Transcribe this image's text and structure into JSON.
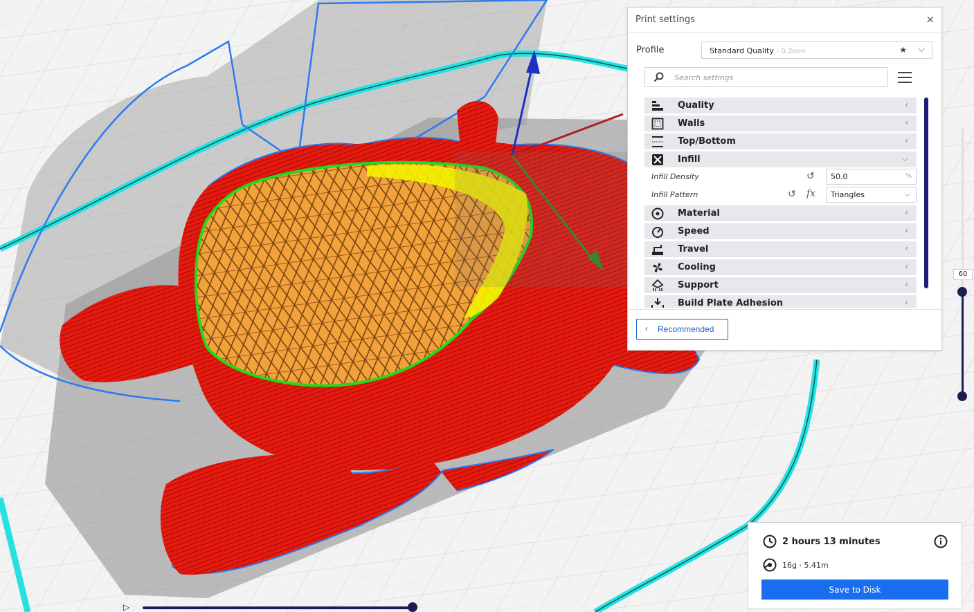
{
  "print_settings": {
    "title": "Print settings",
    "close": "×",
    "profile_label": "Profile",
    "profile_name": "Standard Quality",
    "profile_sub": "- 0.2mm",
    "search_placeholder": "Search settings",
    "categories": [
      {
        "label": "Quality",
        "icon": "quality-icon",
        "expanded": false
      },
      {
        "label": "Walls",
        "icon": "walls-icon",
        "expanded": false
      },
      {
        "label": "Top/Bottom",
        "icon": "top-bottom-icon",
        "expanded": false
      },
      {
        "label": "Infill",
        "icon": "infill-icon",
        "expanded": true
      },
      {
        "label": "Material",
        "icon": "material-icon",
        "expanded": false
      },
      {
        "label": "Speed",
        "icon": "speed-icon",
        "expanded": false
      },
      {
        "label": "Travel",
        "icon": "travel-icon",
        "expanded": false
      },
      {
        "label": "Cooling",
        "icon": "cooling-icon",
        "expanded": false
      },
      {
        "label": "Support",
        "icon": "support-icon",
        "expanded": false
      },
      {
        "label": "Build Plate Adhesion",
        "icon": "adhesion-icon",
        "expanded": false
      }
    ],
    "infill_density_label": "Infill Density",
    "infill_density_value": "50.0",
    "infill_density_unit": "%",
    "infill_pattern_label": "Infill Pattern",
    "infill_pattern_value": "Triangles",
    "recommended_label": "Recommended"
  },
  "layer_slider": {
    "value": "60"
  },
  "summary": {
    "time": "2 hours 13 minutes",
    "material": "16g · 5.41m",
    "save_label": "Save to Disk"
  },
  "colors": {
    "accent": "#196ef0",
    "wall_outer": "#e8190f",
    "wall_inner": "#1ddc1d",
    "infill": "#f2a23a",
    "skin": "#f4f200",
    "support_outline": "#2b7bf0",
    "travel": "#27e0e0",
    "slider": "#1c1c50"
  }
}
